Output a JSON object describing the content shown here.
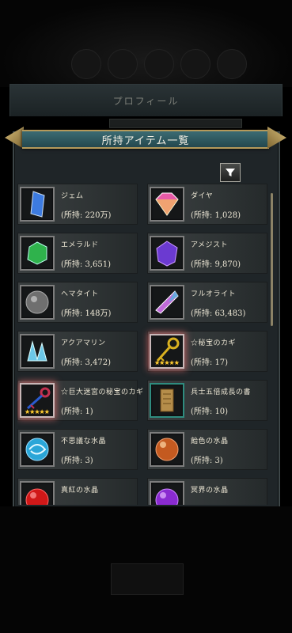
{
  "background": {
    "profile_title": "プロフィール"
  },
  "modal": {
    "title": "所持アイテム一覧",
    "filter_icon": "filter-icon",
    "close_icon": "close-icon"
  },
  "items": [
    {
      "name": "ジェム",
      "count": "(所持: 220万)",
      "icon": "blue-gem-icon",
      "color": "#3d7be0"
    },
    {
      "name": "ダイヤ",
      "count": "(所持: 1,028)",
      "icon": "diamond-icon",
      "color": "#e75aa7"
    },
    {
      "name": "エメラルド",
      "count": "(所持: 3,651)",
      "icon": "emerald-icon",
      "color": "#2fb24c"
    },
    {
      "name": "アメジスト",
      "count": "(所持: 9,870)",
      "icon": "amethyst-icon",
      "color": "#6b3ad1"
    },
    {
      "name": "ヘマタイト",
      "count": "(所持: 148万)",
      "icon": "hematite-icon",
      "color": "#6f6f6f"
    },
    {
      "name": "フルオライト",
      "count": "(所持: 63,483)",
      "icon": "fluorite-icon",
      "color": "#c06ad8"
    },
    {
      "name": "アクアマリン",
      "count": "(所持: 3,472)",
      "icon": "aquamarine-icon",
      "color": "#6cc8e8"
    },
    {
      "name": "☆秘宝のカギ",
      "count": "(所持: 17)",
      "icon": "golden-key-icon",
      "color": "#d8b020",
      "stars": "★★★★★"
    },
    {
      "name": "☆巨大迷宮の秘宝のカギ",
      "count": "(所持: 1)",
      "icon": "dark-key-icon",
      "color": "#c23050",
      "stars": "★★★★★"
    },
    {
      "name": "兵士五倍成長の書",
      "count": "(所持: 10)",
      "icon": "scroll-icon",
      "color": "#b58d4a"
    },
    {
      "name": "不思議な水晶",
      "count": "(所持: 3)",
      "icon": "blue-crystal-orb-icon",
      "color": "#2aa6d8"
    },
    {
      "name": "飴色の水晶",
      "count": "(所持: 3)",
      "icon": "amber-crystal-orb-icon",
      "color": "#c45a20"
    },
    {
      "name": "真紅の水晶",
      "count": "",
      "icon": "crimson-crystal-orb-icon",
      "color": "#d01818"
    },
    {
      "name": "冥界の水晶",
      "count": "",
      "icon": "purple-crystal-orb-icon",
      "color": "#8a2bd0"
    }
  ]
}
